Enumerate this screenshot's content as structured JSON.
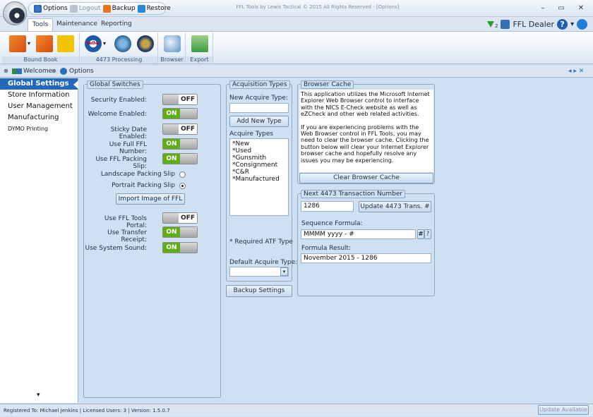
{
  "qat": {
    "options": "Options",
    "logout": "Logout",
    "backup": "Backup",
    "restore": "Restore"
  },
  "window_title": "FFL Tools by Lewis Tactical © 2015 All Rights Reserved - [Options]",
  "window_controls": {
    "minimize": "–",
    "maximize": "▭",
    "close": "✕"
  },
  "ribbon_tabs": [
    "Tools",
    "Maintenance",
    "Reporting"
  ],
  "user": {
    "badge": "2",
    "name": "FFL Dealer",
    "help": "?",
    "nav": "▾"
  },
  "ribbon_groups": [
    {
      "label": "Bound Book"
    },
    {
      "label": "4473 Processing"
    },
    {
      "label": "Browser"
    },
    {
      "label": "Export"
    }
  ],
  "ribbon_icon_text": {
    "seller": "Seller"
  },
  "doc_tabs": {
    "welcome": "Welcome",
    "options": "Options",
    "scroll": "◂ ▸ ✕"
  },
  "nav_items": [
    "Global Settings",
    "Store Information",
    "User Management",
    "Manufacturing",
    "DYMO Printing"
  ],
  "nav_more": "▾",
  "global_switches": {
    "title": "Global Switches",
    "toggles": [
      {
        "label": "Security Enabled:",
        "state": "OFF"
      },
      {
        "label": "Welcome Enabled:",
        "state": "ON"
      },
      {
        "label": "Sticky Date Enabled:",
        "state": "OFF"
      },
      {
        "label": "Use Full FFL Number:",
        "state": "ON"
      },
      {
        "label": "Use FFL Packing Slip:",
        "state": "ON"
      }
    ],
    "landscape": "Landscape Packing Slip",
    "portrait": "Portrait Packing Slip",
    "import_btn": "Import Image of FFL",
    "toggles2": [
      {
        "label": "Use FFL Tools Portal:",
        "state": "OFF"
      },
      {
        "label": "Use Transfer Receipt:",
        "state": "ON"
      },
      {
        "label": "Use System Sound:",
        "state": "ON"
      }
    ]
  },
  "acquisition": {
    "title": "Acquisition Types",
    "new_label": "New Acquire Type:",
    "new_value": "",
    "add_btn": "Add New Type",
    "list_label": "Acquire Types",
    "types": [
      "*New",
      "*Used",
      "*Gunsmith",
      "*Consignment",
      "*C&R",
      "*Manufactured"
    ],
    "required_note": "* Required ATF Type",
    "default_label": "Default Acquire Type:",
    "default_value": "",
    "backup_btn": "Backup Settings"
  },
  "browser_cache": {
    "title": "Browser Cache",
    "text1": "This application utilizes the Microsoft Internet Explorer Web Browser control to interface with the NICS E-Check website as well as eZCheck and other web related activities.",
    "text2": "If you are experiencing problems with the Web Browser control in FFL Tools, you may need to clear the browser cache. Clicking the button below will clear your Internet Explorer browser cache and hopefully resolve any issues you may be experiencing.",
    "clear_btn": "Clear Browser Cache"
  },
  "transaction": {
    "title": "Next 4473 Transaction Number",
    "number": "1286",
    "update_btn": "Update 4473 Trans. #",
    "seq_label": "Sequence Formula:",
    "seq_value": "MMMM yyyy - #",
    "hash_btn": "#",
    "help_btn": "?",
    "result_label": "Formula Result:",
    "result_value": "November 2015 - 1286"
  },
  "status": {
    "text": "Registered To: Michael Jenkins | Licensed Users: 3 | Version: 1.5.0.7",
    "update_btn": "Update Available"
  }
}
